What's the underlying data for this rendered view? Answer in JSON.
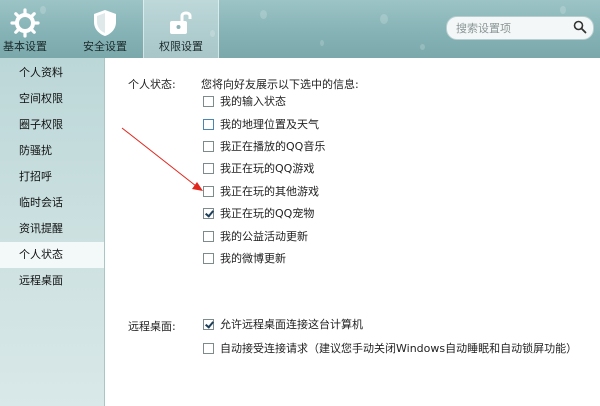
{
  "toolbar": {
    "tabs": [
      {
        "label": "基本设置",
        "icon": "gear-icon"
      },
      {
        "label": "安全设置",
        "icon": "shield-icon"
      },
      {
        "label": "权限设置",
        "icon": "unlock-icon"
      }
    ],
    "search_placeholder": "搜索设置项"
  },
  "sidebar": {
    "items": [
      {
        "label": "个人资料"
      },
      {
        "label": "空间权限"
      },
      {
        "label": "圈子权限"
      },
      {
        "label": "防骚扰"
      },
      {
        "label": "打招呼"
      },
      {
        "label": "临时会话"
      },
      {
        "label": "资讯提醒"
      },
      {
        "label": "个人状态",
        "selected": true
      },
      {
        "label": "远程桌面"
      }
    ]
  },
  "status": {
    "label": "个人状态:",
    "intro": "您将向好友展示以下选中的信息:",
    "options": [
      {
        "label": "我的输入状态",
        "checked": false
      },
      {
        "label": "我的地理位置及天气",
        "checked": false
      },
      {
        "label": "我正在播放的QQ音乐",
        "checked": false
      },
      {
        "label": "我正在玩的QQ游戏",
        "checked": false
      },
      {
        "label": "我正在玩的其他游戏",
        "checked": false
      },
      {
        "label": "我正在玩的QQ宠物",
        "checked": true
      },
      {
        "label": "我的公益活动更新",
        "checked": false
      },
      {
        "label": "我的微博更新",
        "checked": false
      }
    ]
  },
  "remote": {
    "label": "远程桌面:",
    "options": [
      {
        "label": "允许远程桌面连接这台计算机",
        "checked": true
      },
      {
        "label": "自动接受连接请求（建议您手动关闭Windows自动睡眠和自动锁屏功能）",
        "checked": false
      }
    ]
  },
  "colors": {
    "toolbar_bg": "#86b3b6",
    "sidebar_bg": "#cfe2e2",
    "annotation_arrow": "#e0261c"
  }
}
